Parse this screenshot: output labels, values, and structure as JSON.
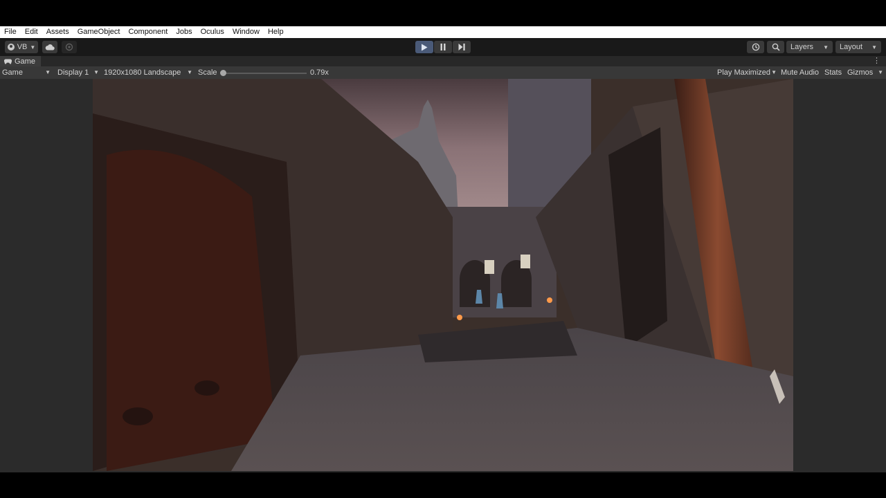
{
  "menu": [
    "File",
    "Edit",
    "Assets",
    "GameObject",
    "Component",
    "Jobs",
    "Oculus",
    "Window",
    "Help"
  ],
  "toolbar": {
    "account_label": "VB",
    "layers_label": "Layers",
    "layout_label": "Layout"
  },
  "tab": {
    "label": "Game"
  },
  "game_view": {
    "display_mode": "Game",
    "display": "Display 1",
    "resolution": "1920x1080 Landscape",
    "scale_label": "Scale",
    "scale_value": "0.79x",
    "play_mode": "Play Maximized",
    "mute_audio": "Mute Audio",
    "stats": "Stats",
    "gizmos": "Gizmos"
  },
  "icons": {
    "account": "account-icon",
    "cloud": "cloud-icon",
    "collab": "collab-icon",
    "play": "play-icon",
    "pause": "pause-icon",
    "step": "step-icon",
    "history": "history-icon",
    "search": "search-icon",
    "tab": "gamepad-icon",
    "more": "kebab-icon"
  },
  "colors": {
    "menubar": "#ffffff",
    "toolbar": "#191919",
    "play_active": "#4a5a78",
    "gameview_toolbar": "#383838",
    "viewport_bg": "#2b2b2b"
  }
}
